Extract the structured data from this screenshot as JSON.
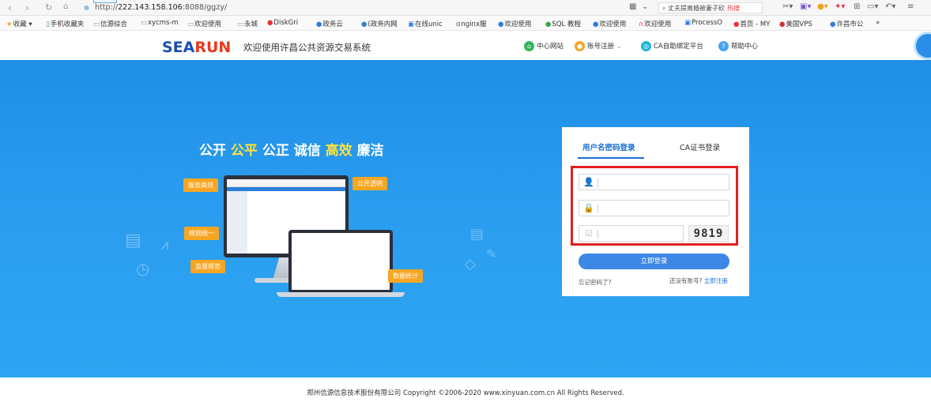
{
  "browser": {
    "url_prefix": "http://",
    "url_host": "222.143.158.106",
    "url_rest": ":8088/ggzy/",
    "search_text": "丈夫提离婚被妻子砍",
    "search_hot": "热搜",
    "bookmarks": [
      "收藏",
      "手机收藏夹",
      "信源综合",
      "xycms-m",
      "欢迎使用",
      "永城",
      "DiskGri",
      "政务云",
      "(政务内网",
      "在线unic",
      "nginx服",
      "欢迎使用",
      "SQL 教程",
      "欢迎使用",
      "欢迎使用",
      "ProcessO",
      "首页 - MY",
      "美国VPS",
      "许昌市公",
      "»"
    ]
  },
  "header": {
    "logo_main": "SEA",
    "logo_accent": "RUN",
    "title": "欢迎使用许昌公共资源交易系统",
    "nav": [
      "中心网站",
      "账号注册",
      "CA自助绑定平台",
      "帮助中心"
    ]
  },
  "hero": {
    "slogan_parts": [
      "公开 ",
      "公平",
      " 公正  诚信 ",
      "高效",
      " 廉洁"
    ],
    "tags": [
      "服务高效",
      "公开透明",
      "规则统一",
      "监督规范",
      "数据统计"
    ]
  },
  "login": {
    "tab_user": "用户名密码登录",
    "tab_ca": "CA证书登录",
    "username_placeholder": "",
    "password_placeholder": "",
    "captcha_placeholder": "",
    "captcha_code": "9819",
    "submit_label": "立即登录",
    "forgot_label": "忘记密码了?",
    "no_account_label": "还没有账号?",
    "register_label": "立即注册"
  },
  "footer": {
    "copyright": "郑州信源信息技术股份有限公司 Copyright ©2006-2020 www.xinyuan.com.cn All Rights Reserved."
  },
  "colors": {
    "hero_blue": "#2a9cef",
    "accent_yellow": "#ffe23a",
    "tag_orange": "#f7a623",
    "button_blue": "#3d88e6",
    "highlight_red": "#e02020"
  }
}
